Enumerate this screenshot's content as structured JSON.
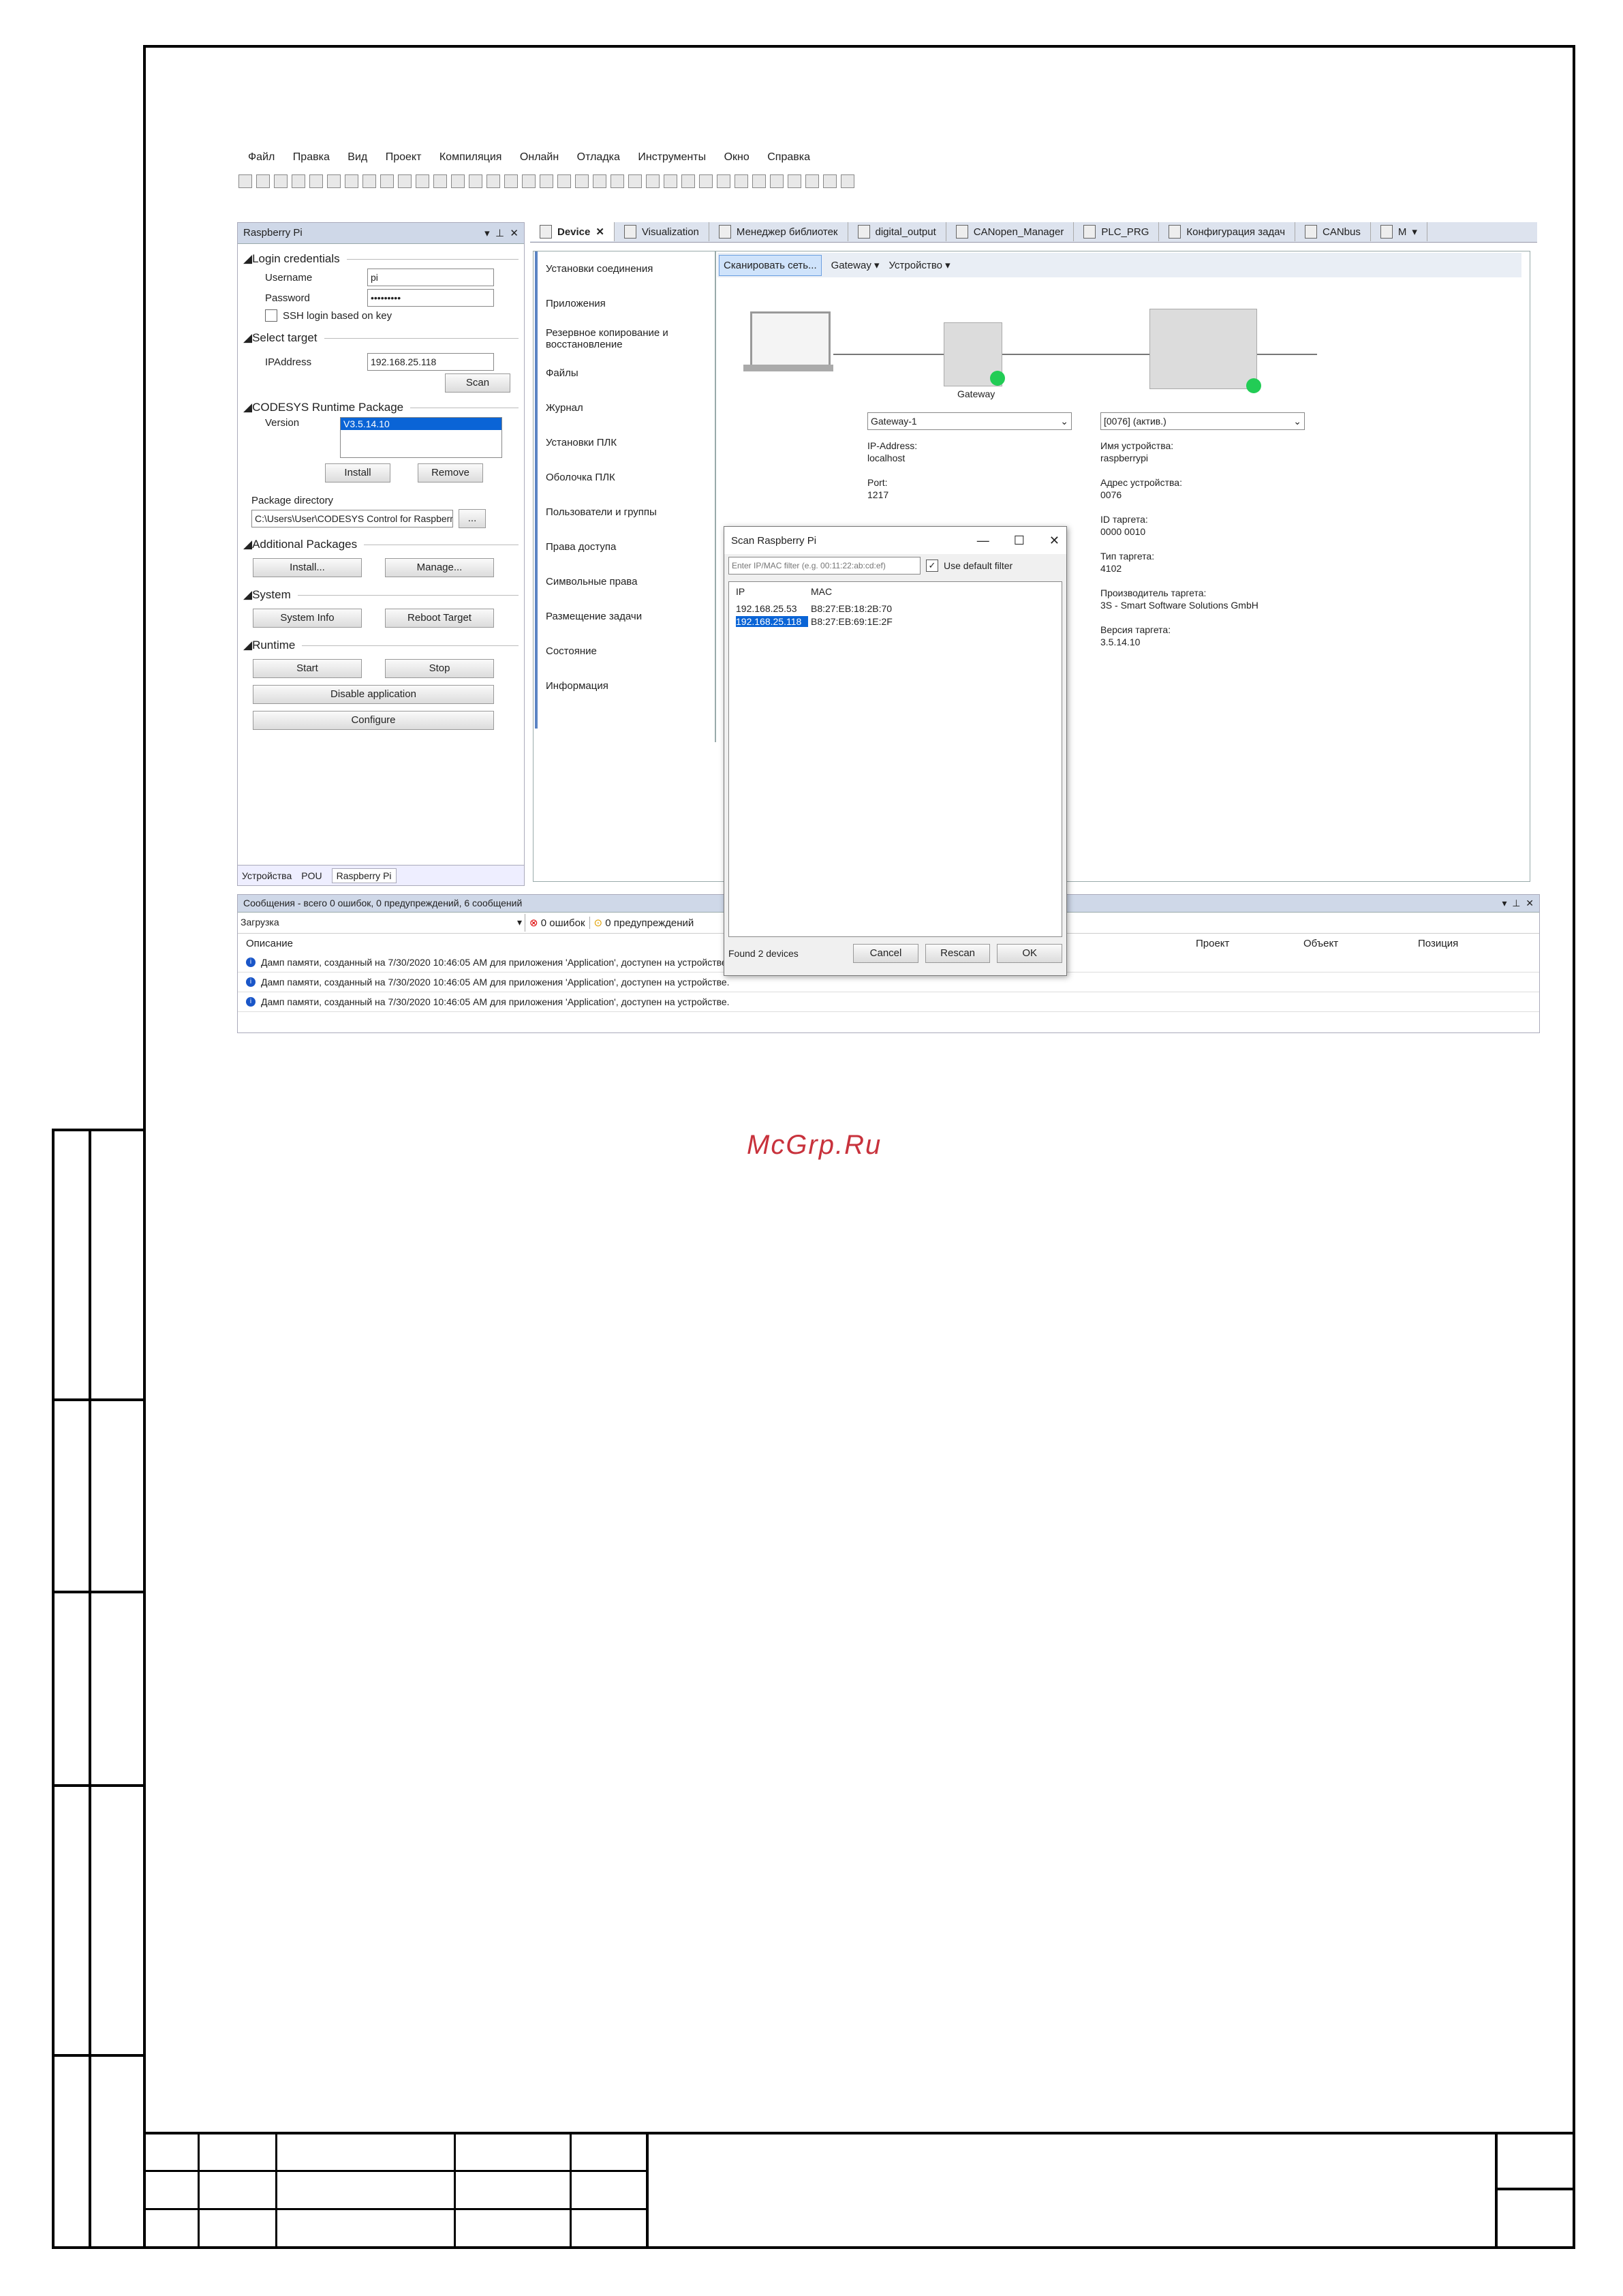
{
  "menu": [
    "Файл",
    "Правка",
    "Вид",
    "Проект",
    "Компиляция",
    "Онлайн",
    "Отладка",
    "Инструменты",
    "Окно",
    "Справка"
  ],
  "left_panel": {
    "title": "Raspberry Pi",
    "login_section": "Login credentials",
    "username_label": "Username",
    "username_value": "pi",
    "password_label": "Password",
    "password_value": "•••••••••",
    "ssh_label": "SSH login based on key",
    "select_target_section": "Select target",
    "ip_label": "IPAddress",
    "ip_value": "192.168.25.118",
    "scan_button": "Scan",
    "runtime_pkg_section": "CODESYS Runtime Package",
    "version_label": "Version",
    "version_value": "V3.5.14.10",
    "install_button": "Install",
    "remove_button": "Remove",
    "pkg_dir_label": "Package directory",
    "pkg_dir_value": "C:\\Users\\User\\CODESYS Control for Raspberr",
    "browse_button": "...",
    "additional_section": "Additional Packages",
    "install2_button": "Install...",
    "manage_button": "Manage...",
    "system_section": "System",
    "sysinfo_button": "System Info",
    "reboot_button": "Reboot Target",
    "runtime_section": "Runtime",
    "start_button": "Start",
    "stop_button": "Stop",
    "disable_button": "Disable application",
    "configure_button": "Configure",
    "bottom_tabs": [
      "Устройства",
      "POU",
      "Raspberry Pi"
    ]
  },
  "editor_tabs": [
    "Device",
    "Visualization",
    "Менеджер библиотек",
    "digital_output",
    "CANopen_Manager",
    "PLC_PRG",
    "Конфигурация задач",
    "CANbus",
    "M"
  ],
  "device_nav": [
    "Установки соединения",
    "Приложения",
    "Резервное копирование и восстановление",
    "Файлы",
    "Журнал",
    "Установки ПЛК",
    "Оболочка ПЛК",
    "Пользователи и группы",
    "Права доступа",
    "Символьные права",
    "Размещение задачи",
    "Состояние",
    "Информация"
  ],
  "device_toolbar": {
    "scan": "Сканировать сеть...",
    "gateway": "Gateway ▾",
    "device": "Устройство ▾"
  },
  "gateway": {
    "caption": "Gateway",
    "select": "Gateway-1",
    "ip_label": "IP-Address:",
    "ip_value": "localhost",
    "port_label": "Port:",
    "port_value": "1217"
  },
  "device_info": {
    "select": "[0076] (актив.)",
    "name_label": "Имя устройства:",
    "name_value": "raspberrypi",
    "addr_label": "Адрес устройства:",
    "addr_value": "0076",
    "id_label": "ID таргета:",
    "id_value": "0000  0010",
    "type_label": "Тип таргета:",
    "type_value": "4102",
    "vendor_label": "Производитель таргета:",
    "vendor_value": "3S - Smart Software Solutions GmbH",
    "version_label": "Версия таргета:",
    "version_value": "3.5.14.10"
  },
  "dialog": {
    "title": "Scan Raspberry Pi",
    "filter_placeholder": "Enter IP/MAC filter (e.g. 00:11:22:ab:cd:ef)",
    "default_filter": "Use default filter",
    "col_ip": "IP",
    "col_mac": "MAC",
    "rows": [
      {
        "ip": "192.168.25.53",
        "mac": "B8:27:EB:18:2B:70"
      },
      {
        "ip": "192.168.25.118",
        "mac": "B8:27:EB:69:1E:2F"
      }
    ],
    "status": "Found 2 devices",
    "cancel": "Cancel",
    "rescan": "Rescan",
    "ok": "OK"
  },
  "messages": {
    "header": "Сообщения - всего 0 ошибок, 0 предупреждений, 6 сообщений",
    "source": "Загрузка",
    "errors": "0 ошибок",
    "warnings": "0 предупреждений",
    "col_desc": "Описание",
    "col_project": "Проект",
    "col_object": "Объект",
    "col_position": "Позиция",
    "rows": [
      "Дамп памяти, созданный на 7/30/2020 10:46:05 AM для приложения 'Application', доступен на устройстве.",
      "Дамп памяти, созданный на 7/30/2020 10:46:05 AM для приложения 'Application', доступен на устройстве.",
      "Дамп памяти, созданный на 7/30/2020 10:46:05 AM для приложения 'Application', доступен на устройстве."
    ]
  },
  "watermark": "McGrp.Ru"
}
